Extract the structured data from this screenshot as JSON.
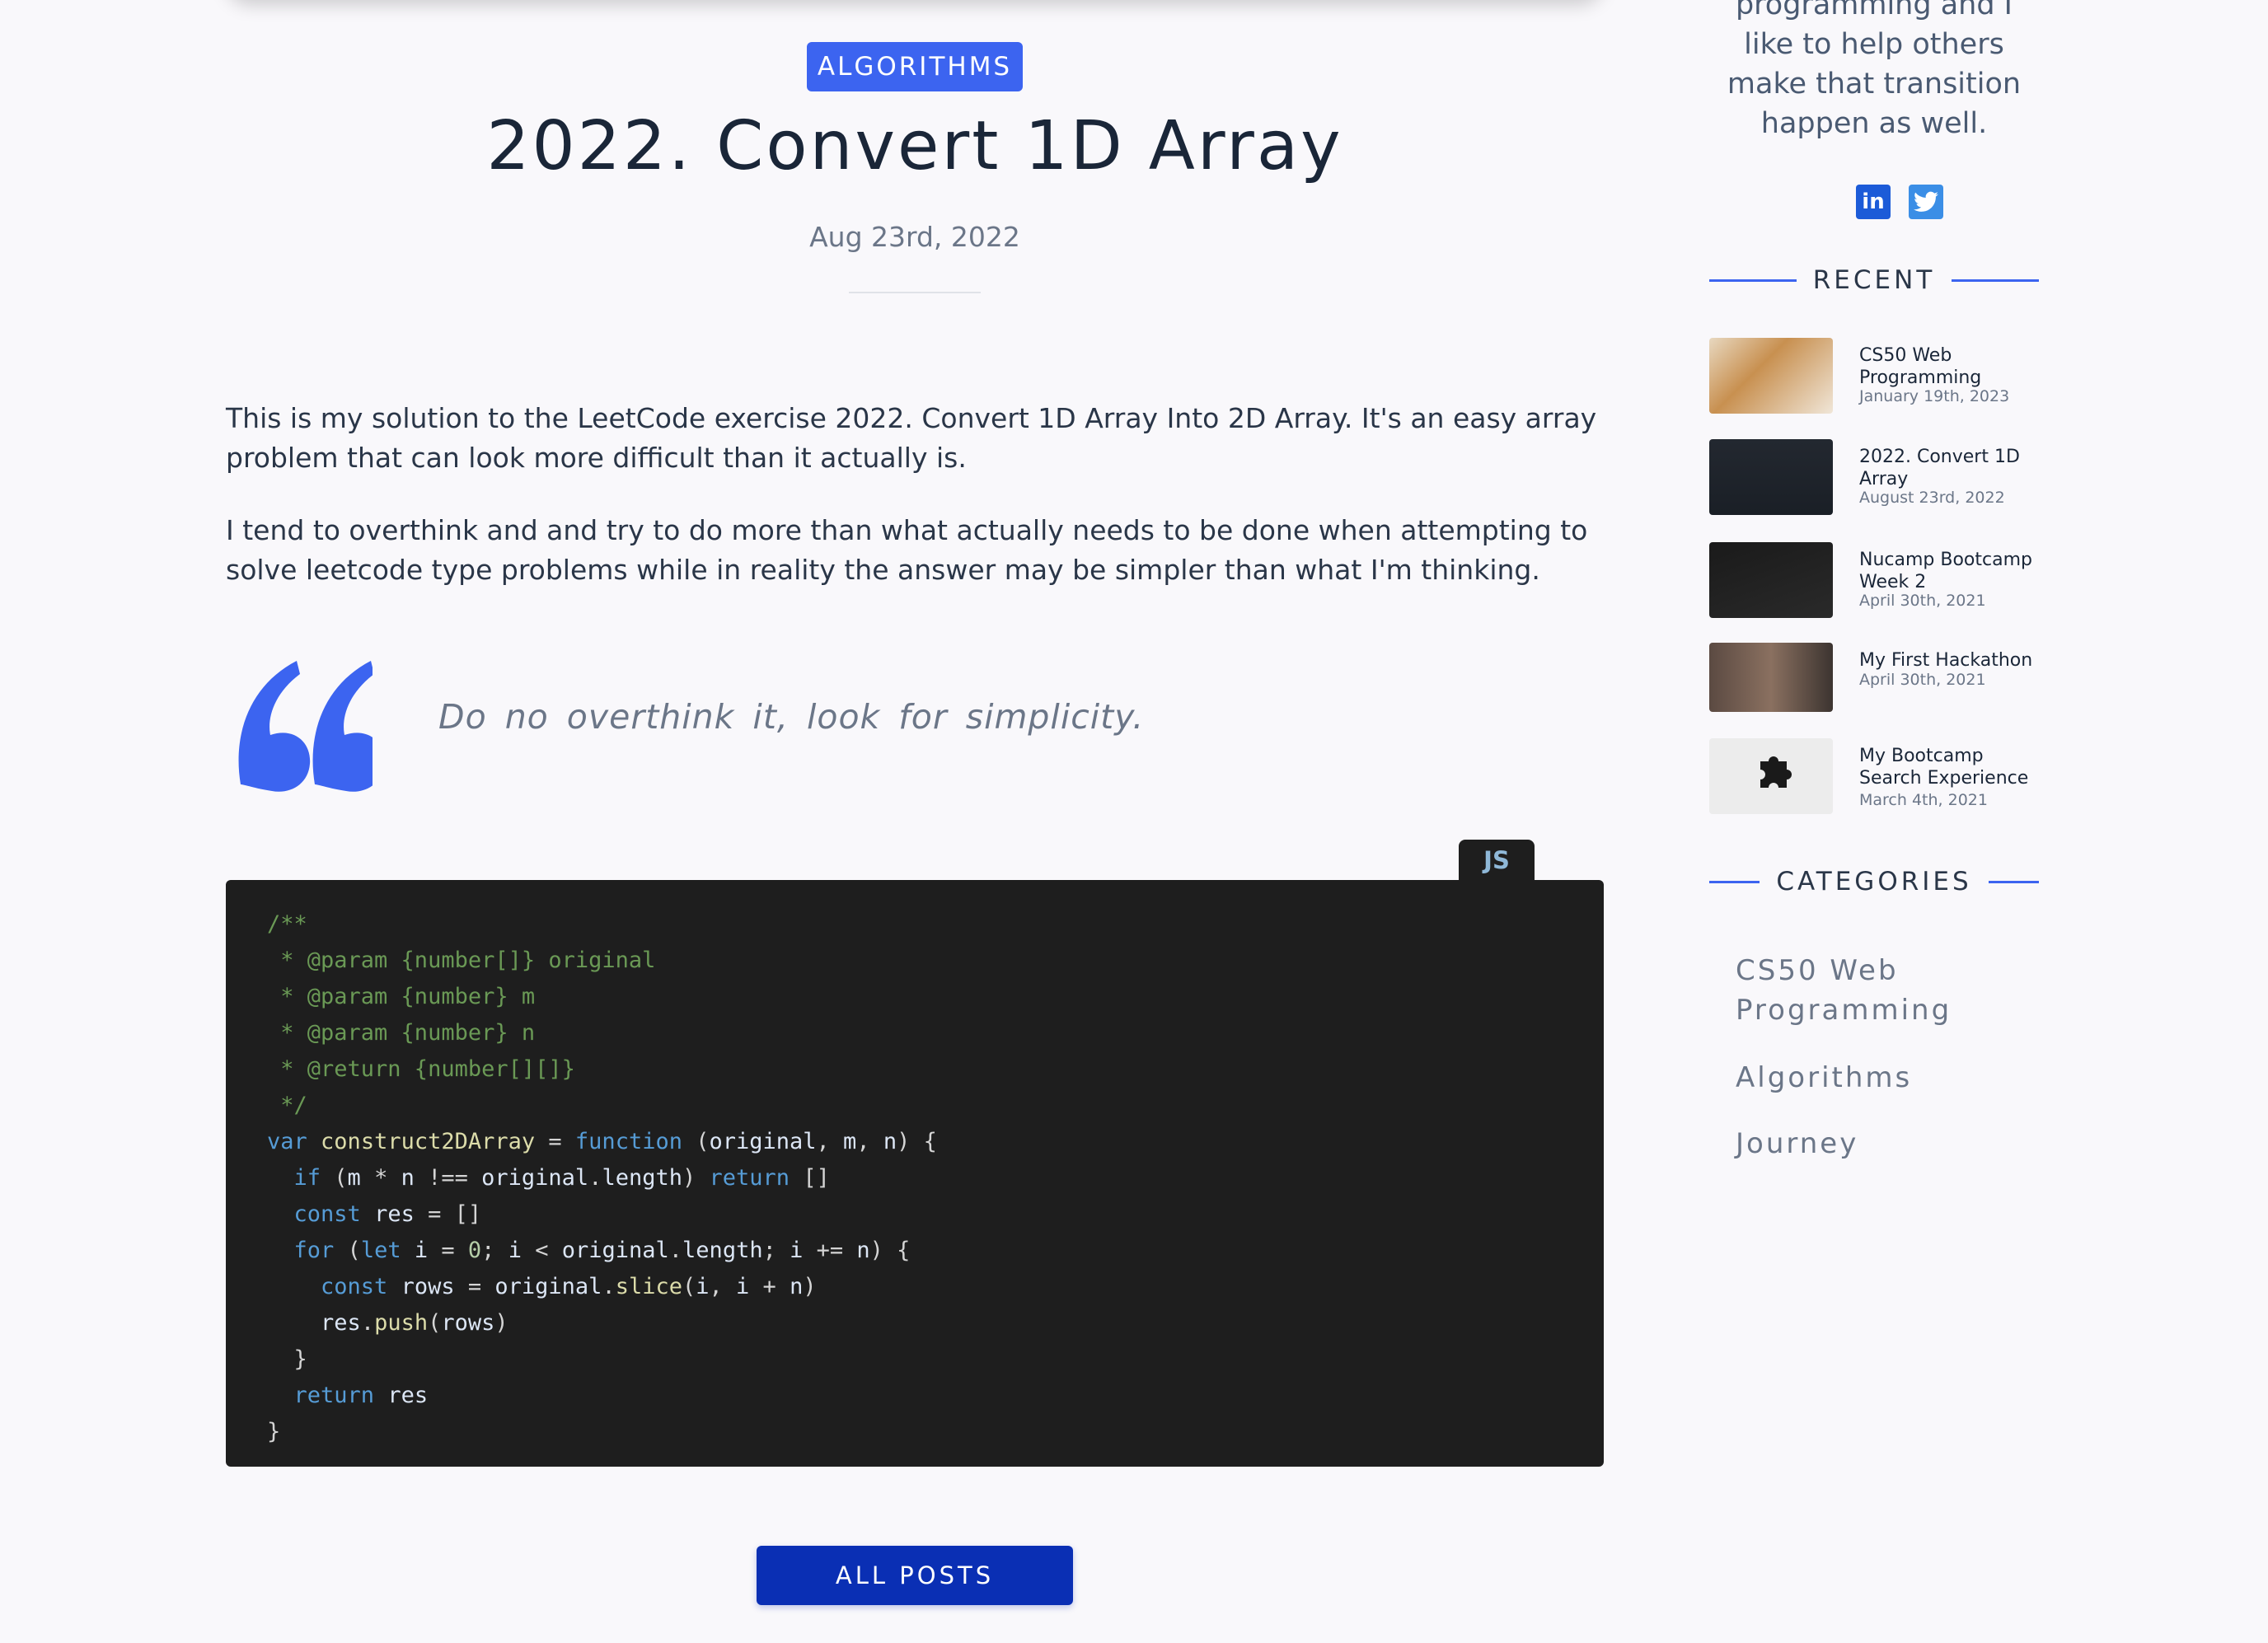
{
  "post": {
    "category": "ALGORITHMS",
    "title": "2022. Convert 1D Array",
    "date": "Aug 23rd, 2022",
    "paragraphs": [
      "This is my solution to the LeetCode exercise 2022. Convert 1D Array Into 2D Array. It's an easy array problem that can look more difficult than it actually is.",
      "I tend to overthink and and try to do more than what actually needs to be done when attempting to solve leetcode type problems while in reality the answer may be simpler than what I'm thinking."
    ],
    "quote": "Do no overthink it, look for simplicity.",
    "code_language": "JS",
    "all_posts_label": "ALL POSTS"
  },
  "sidebar": {
    "bio": "programming and I like to help others make that transition happen as well.",
    "social": {
      "linkedin": "in",
      "twitter": "t"
    },
    "recent_heading": "RECENT",
    "recent": [
      {
        "title": "CS50 Web Programming",
        "date": "January 19th, 2023"
      },
      {
        "title": "2022. Convert 1D Array",
        "date": "August 23rd, 2022"
      },
      {
        "title": "Nucamp Bootcamp Week 2",
        "date": "April 30th, 2021"
      },
      {
        "title": "My First Hackathon",
        "date": "April 30th, 2021"
      },
      {
        "title": "My Bootcamp Search Experience",
        "date": "March 4th, 2021"
      }
    ],
    "categories_heading": "CATEGORIES",
    "categories": [
      "CS50 Web Programming",
      "Algorithms",
      "Journey"
    ]
  },
  "icons": {
    "quote": "quote-icon",
    "linkedin": "linkedin-icon",
    "twitter": "twitter-icon"
  },
  "colors": {
    "accent": "#3c64f0",
    "button": "#0a2fb4",
    "code_bg": "#1e1e1e"
  }
}
